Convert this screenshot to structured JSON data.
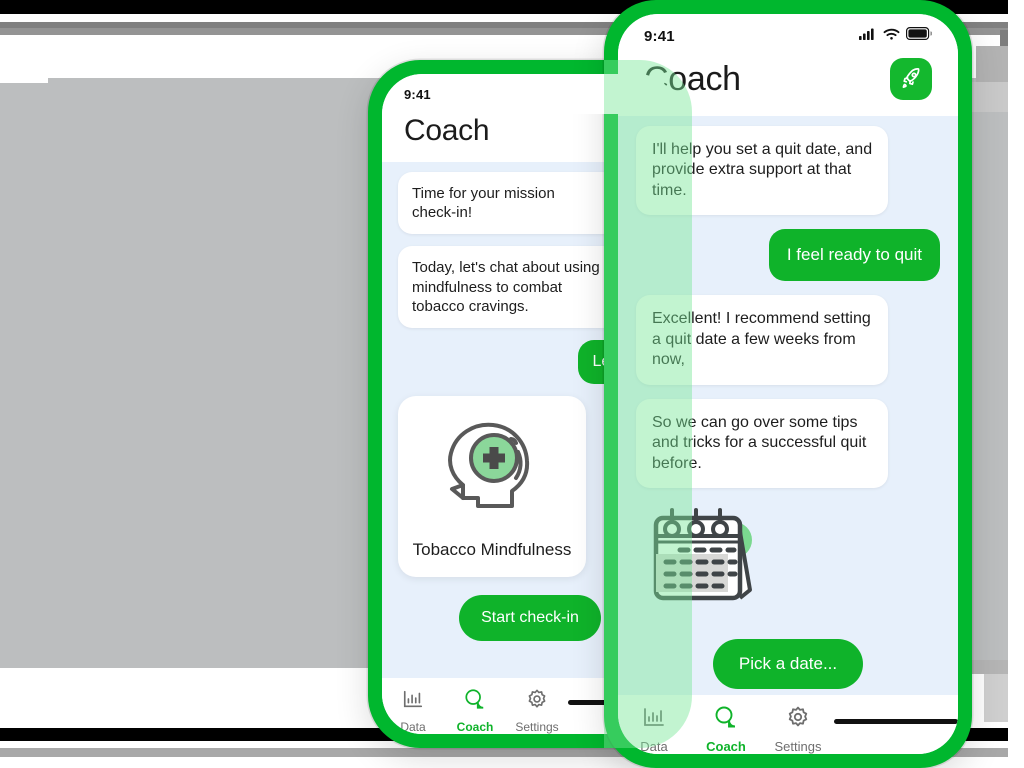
{
  "app": {
    "title": "Coach",
    "accent_green": "#00B72E",
    "bubble_green": "#0FB32A",
    "chat_background": "#e7f0fb"
  },
  "status_bar": {
    "time": "9:41",
    "icons": [
      "signal-icon",
      "wifi-icon",
      "battery-icon"
    ]
  },
  "phone_front": {
    "header": {
      "title": "Coach",
      "action_icon": "rocket-icon"
    },
    "messages": [
      {
        "from": "coach",
        "text": "I'll help you set a quit date, and provide extra support at that time."
      },
      {
        "from": "user",
        "text": "I feel ready to quit"
      },
      {
        "from": "coach",
        "text": "Excellent! I recommend setting a quit date a few weeks from now,"
      },
      {
        "from": "coach",
        "text": "So we can go over some tips and tricks for a successful quit before."
      }
    ],
    "illustration": "calendar-illustration",
    "cta_label": "Pick a date...",
    "tabs": [
      {
        "label": "Data",
        "icon": "bar-chart-icon",
        "active": false
      },
      {
        "label": "Coach",
        "icon": "chat-bubbles-icon",
        "active": true
      },
      {
        "label": "Settings",
        "icon": "gear-icon",
        "active": false
      }
    ]
  },
  "phone_back": {
    "header": {
      "title": "Coach"
    },
    "messages": [
      {
        "from": "coach",
        "text": "Time for your mission check-in!"
      },
      {
        "from": "coach",
        "text": "Today, let's chat about using mindfulness to combat tobacco cravings."
      },
      {
        "from": "user",
        "text": "Let's go"
      }
    ],
    "card": {
      "title": "Tobacco Mindfulness",
      "icon": "head-mindfulness-icon"
    },
    "cta_label": "Start check-in",
    "tabs": [
      {
        "label": "Data",
        "icon": "bar-chart-icon",
        "active": false
      },
      {
        "label": "Coach",
        "icon": "chat-bubbles-icon",
        "active": true
      },
      {
        "label": "Settings",
        "icon": "gear-icon",
        "active": false
      }
    ]
  }
}
